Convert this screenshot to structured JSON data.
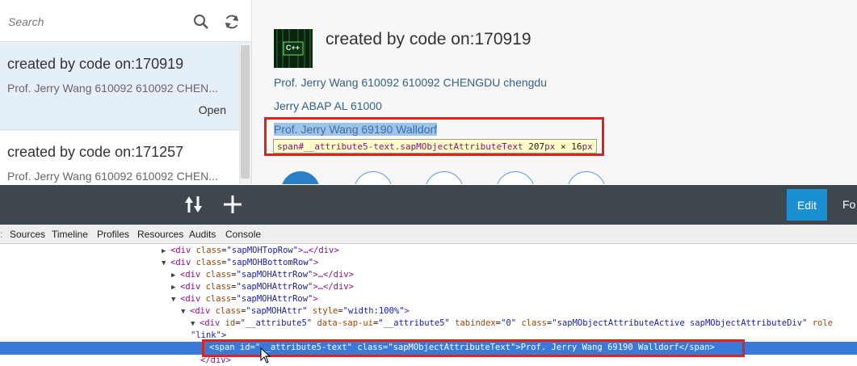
{
  "master": {
    "search_placeholder": "Search",
    "search_icon": "search-icon",
    "refresh_icon": "refresh-icon",
    "items": [
      {
        "title": "created by code on:170919",
        "description": "Prof. Jerry Wang 610092 610092 CHEN...",
        "status": "Open"
      },
      {
        "title": "created by code on:171257",
        "description": "Prof. Jerry Wang 610092 610092 CHEN..."
      }
    ]
  },
  "detail": {
    "title": "created by code on:170919",
    "avatar_label": "C++",
    "attributes": [
      "Prof. Jerry Wang 610092 610092 CHENGDU chengdu",
      "Jerry ABAP AL 61000",
      "Prof. Jerry Wang 69190 Walldorf"
    ],
    "tooltip": {
      "selector": "span#__attribute5-text.sapMObjectAttributeText",
      "width": "207",
      "sep": " × ",
      "height": "16",
      "unit": "px"
    }
  },
  "toolbar": {
    "sort_icon": "sort-icon",
    "add_icon": "add-icon",
    "edit_label": "Edit",
    "fo_label": "Fo"
  },
  "devtools": {
    "tabs": [
      "Sources",
      "Timeline",
      "Profiles",
      "Resources",
      "Audits",
      "Console"
    ],
    "lines": [
      {
        "t1": "<div ",
        "a1": "class",
        "v1": "\"sapMOHTopRow\"",
        "t2": ">…</div>"
      },
      {
        "t1": "<div ",
        "a1": "class",
        "v1": "\"sapMOHBottomRow\"",
        "t2": ">"
      },
      {
        "t1": "<div ",
        "a1": "class",
        "v1": "\"sapMOHAttrRow\"",
        "t2": ">…</div>"
      },
      {
        "t1": "<div ",
        "a1": "class",
        "v1": "\"sapMOHAttrRow\"",
        "t2": ">…</div>"
      },
      {
        "t1": "<div ",
        "a1": "class",
        "v1": "\"sapMOHAttrRow\"",
        "t2": ">"
      },
      {
        "t1": "<div ",
        "a1": "class",
        "v1": "\"sapMOHAttr\"",
        "a2": "style",
        "v2": "\"width:100%\"",
        "t2": ">"
      },
      {
        "t1": "<div ",
        "a1": "id",
        "v1": "\"__attribute5\"",
        "a2": "data-sap-ui",
        "v2": "\"__attribute5\"",
        "a3": "tabindex",
        "v3": "\"0\"",
        "a4": "class",
        "v4": "\"sapMObjectAttributeActive sapMObjectAttributeDiv\"",
        "a5": "role",
        "v5": ""
      },
      {
        "text": "\"link\">"
      },
      {
        "selected": "<span id=\"__attribute5-text\" class=\"sapMObjectAttributeText\">Prof. Jerry Wang 69190 Walldorf</span>"
      },
      {
        "t1": "</div>"
      }
    ]
  },
  "colors": {
    "accent": "#1a8fd1",
    "toolbar": "#3f474e",
    "highlight_box": "#d9261c",
    "selection": "#3879d9"
  }
}
